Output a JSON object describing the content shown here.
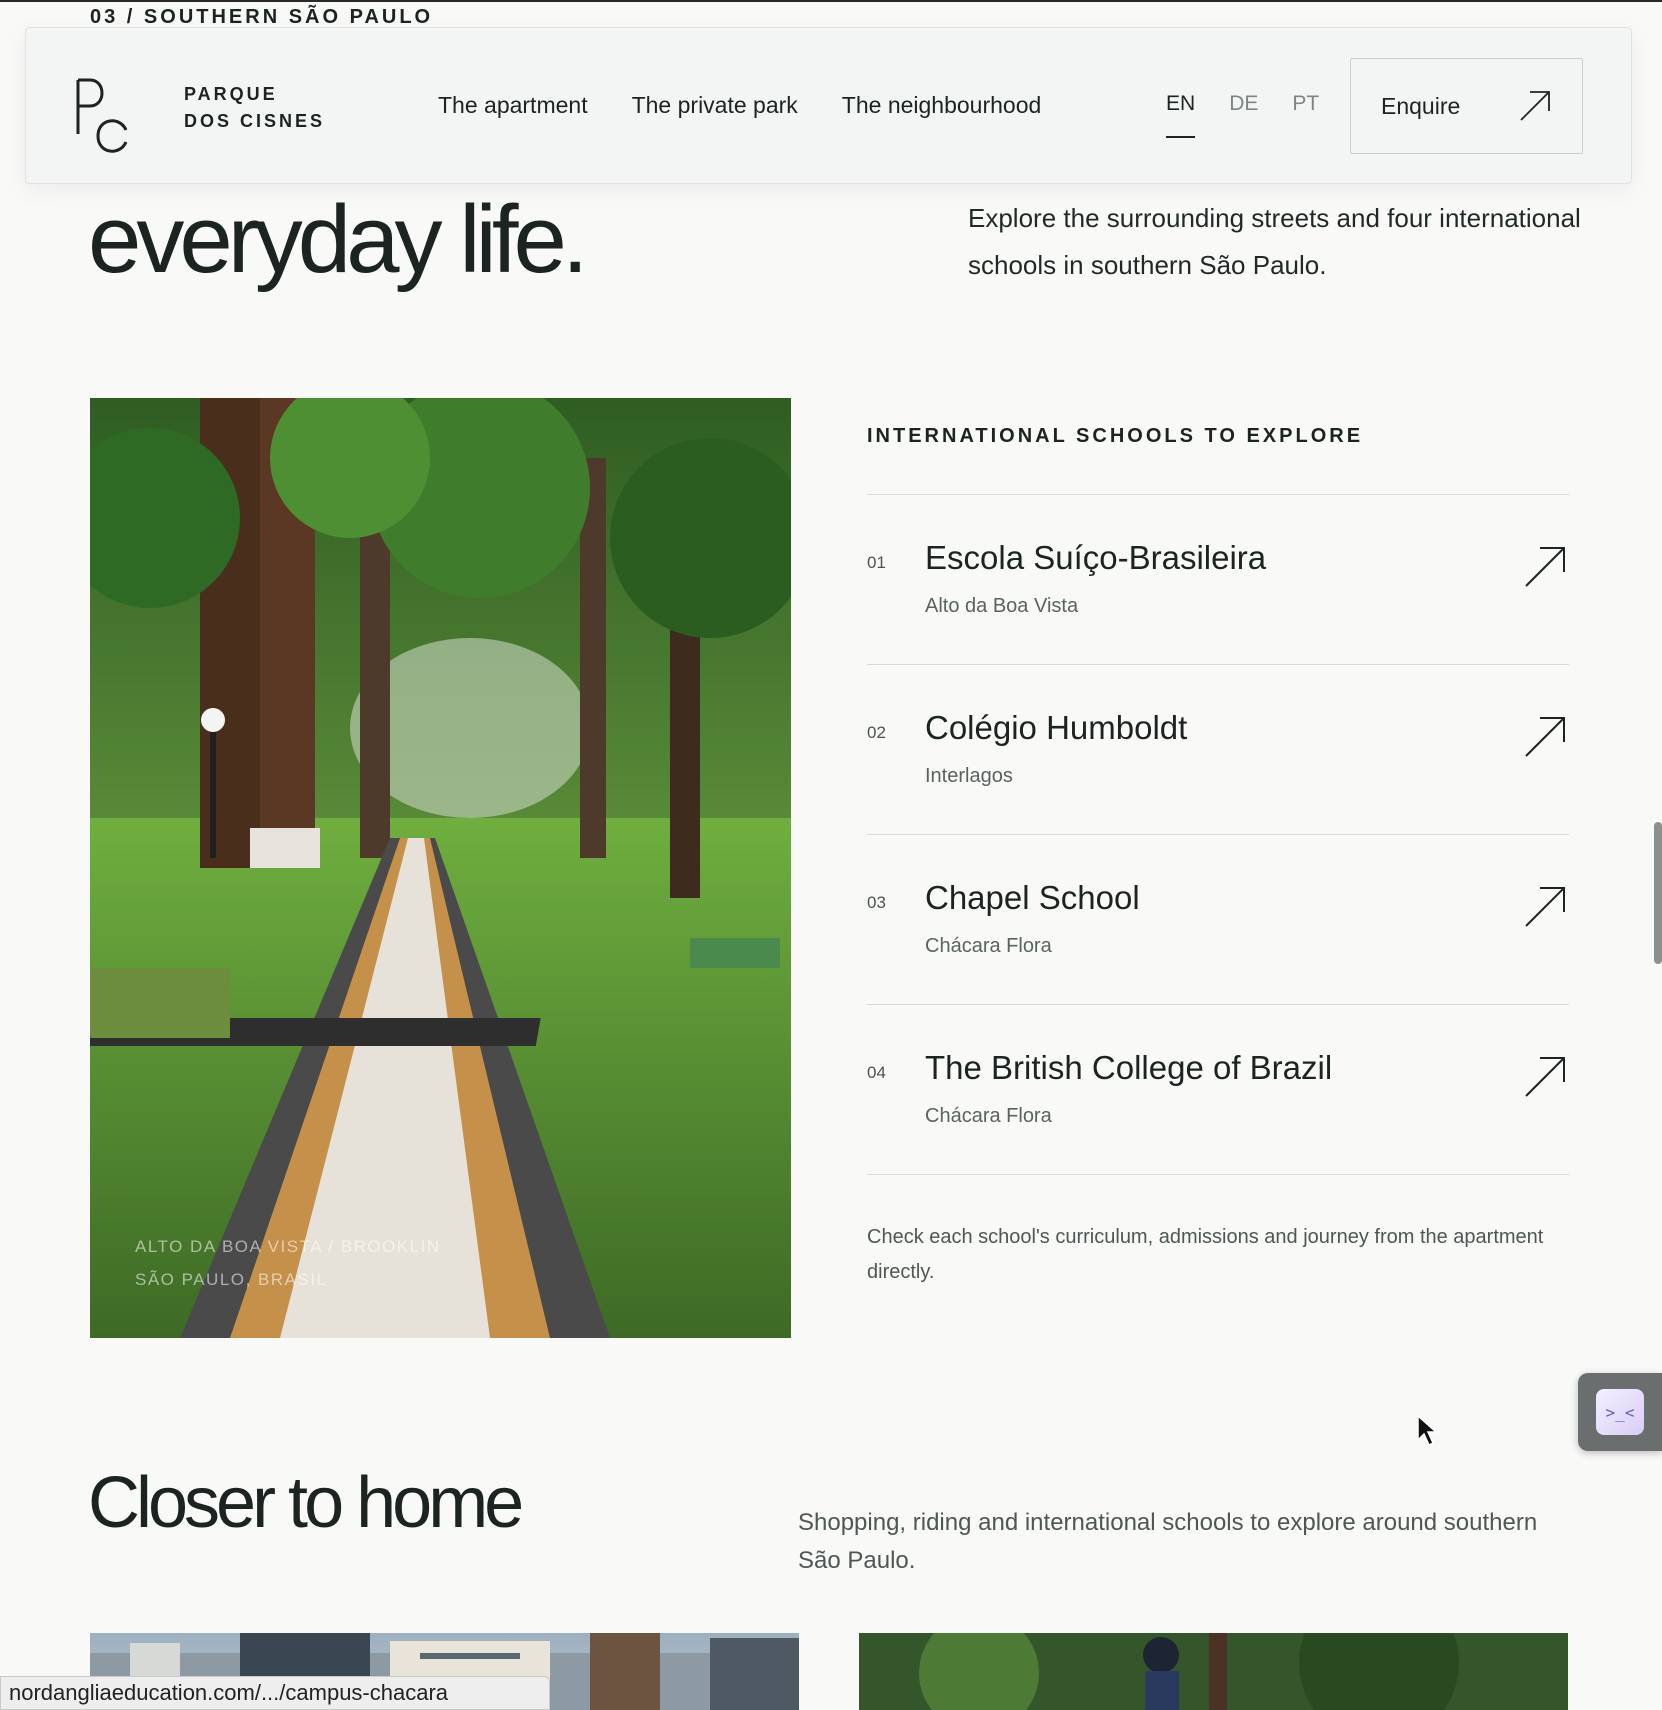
{
  "section_label": "03 / SOUTHERN SÃO PAULO",
  "header": {
    "logo_letters": "PC",
    "brand_line1": "PARQUE",
    "brand_line2": "DOS CISNES",
    "nav": [
      "The apartment",
      "The private park",
      "The neighbourhood"
    ],
    "languages": [
      "EN",
      "DE",
      "PT"
    ],
    "active_language": "EN",
    "enquire_label": "Enquire"
  },
  "intro": {
    "hero_title": "everyday life.",
    "text": "Explore the surrounding streets and four international schools in southern São Paulo."
  },
  "photo": {
    "caption_line1": "ALTO DA BOA VISTA / BROOKLIN",
    "caption_line2": "SÃO PAULO, BRASIL"
  },
  "schools": {
    "heading": "INTERNATIONAL SCHOOLS TO EXPLORE",
    "items": [
      {
        "num": "01",
        "name": "Escola Suíço-Brasileira",
        "area": "Alto da Boa Vista"
      },
      {
        "num": "02",
        "name": "Colégio Humboldt",
        "area": "Interlagos"
      },
      {
        "num": "03",
        "name": "Chapel School",
        "area": "Chácara Flora"
      },
      {
        "num": "04",
        "name": "The British College of Brazil",
        "area": "Chácara Flora"
      }
    ],
    "note": "Check each school's curriculum, admissions and journey from the apartment directly."
  },
  "closer": {
    "title": "Closer to home",
    "text": "Shopping, riding and international schools to explore around southern São Paulo."
  },
  "status_url": "nordangliaeducation.com/.../campus-chacara"
}
